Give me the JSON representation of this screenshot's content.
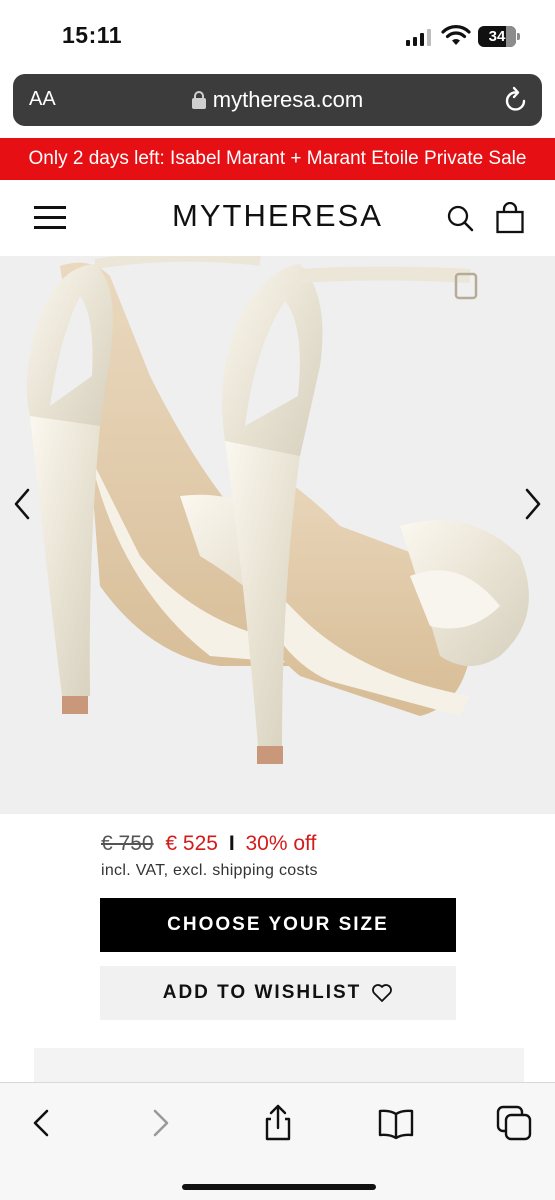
{
  "status_bar": {
    "time": "15:11",
    "battery": "34"
  },
  "browser": {
    "text_size_label": "AA",
    "url": "mytheresa.com"
  },
  "promo_banner": {
    "text": "Only 2 days left: Isabel Marant + Marant Etoile Private Sale",
    "color": "#e60f14"
  },
  "header": {
    "logo": "MYTHERESA"
  },
  "product": {
    "image_description": "ivory satin platform sandals, rear view",
    "old_price": "€ 750",
    "new_price": "€ 525",
    "separator": "I",
    "discount": "30% off",
    "vat_note": "incl. VAT, excl. shipping costs"
  },
  "actions": {
    "choose_size_label": "CHOOSE YOUR SIZE",
    "wishlist_label": "ADD TO WISHLIST"
  },
  "colors": {
    "sale_red": "#d51a1a",
    "primary_button": "#000000",
    "secondary_button": "#f1f1f1"
  },
  "toolbar_icons": [
    "back-icon",
    "forward-icon",
    "share-icon",
    "bookmarks-icon",
    "tabs-icon"
  ]
}
